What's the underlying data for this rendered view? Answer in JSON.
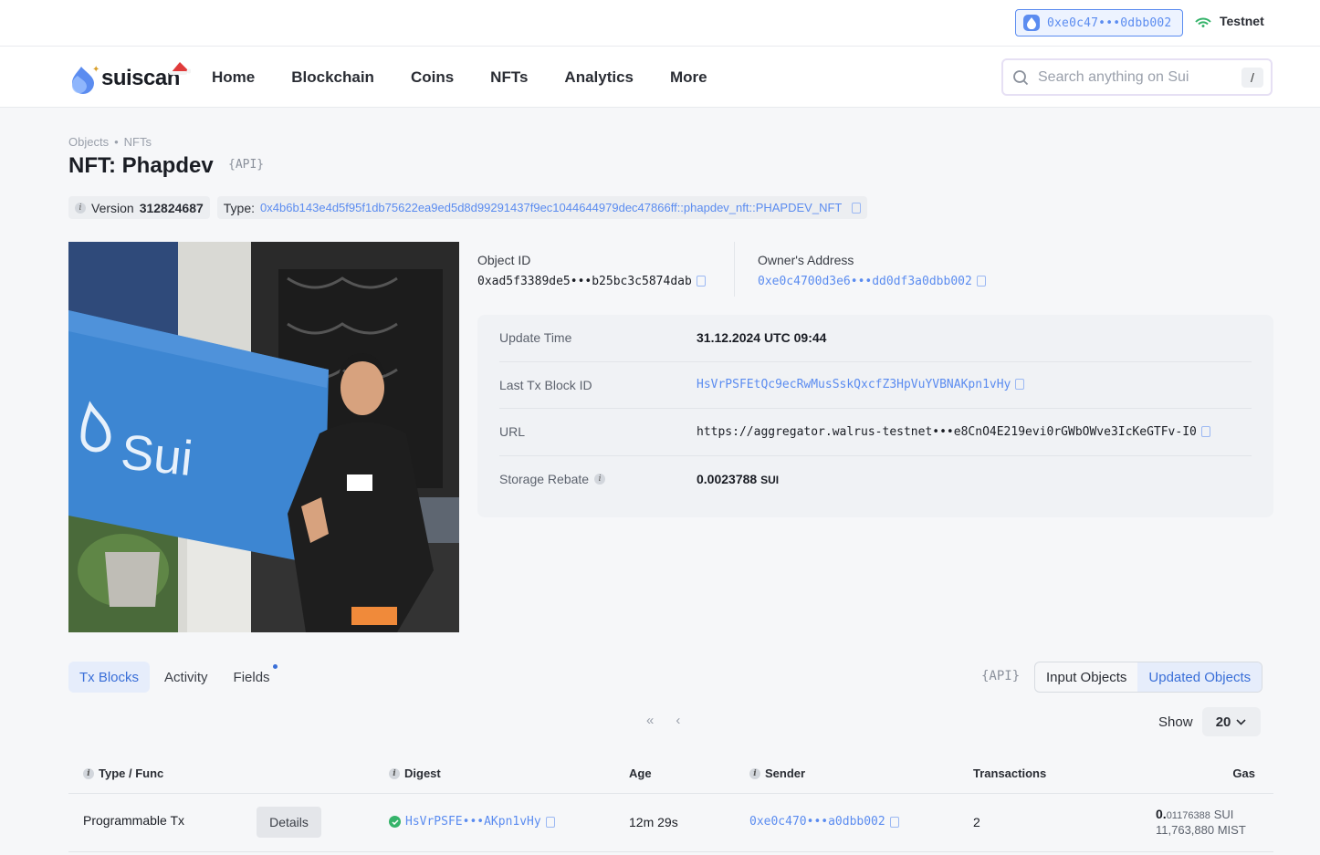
{
  "topbar": {
    "wallet_address": "0xe0c47•••0dbb002",
    "network": "Testnet"
  },
  "nav": {
    "logo_text": "suiscan",
    "items": [
      "Home",
      "Blockchain",
      "Coins",
      "NFTs",
      "Analytics",
      "More"
    ],
    "search_placeholder": "Search anything on Sui",
    "search_shortcut": "/"
  },
  "breadcrumb": {
    "items": [
      "Objects",
      "NFTs"
    ],
    "separator": "•"
  },
  "page": {
    "title": "NFT: Phapdev",
    "api_label": "{API}",
    "version_label": "Version",
    "version_value": "312824687",
    "type_label": "Type:",
    "type_value": "0x4b6b143e4d5f95f1db75622ea9ed5d8d99291437f9ec1044644979dec47866ff::phapdev_nft::PHAPDEV_NFT"
  },
  "ids": {
    "object_id_label": "Object ID",
    "object_id_value": "0xad5f3389de5•••b25bc3c5874dab",
    "owner_label": "Owner's Address",
    "owner_value": "0xe0c4700d3e6•••dd0df3a0dbb002"
  },
  "details": {
    "update_time_label": "Update Time",
    "update_time_value": "31.12.2024 UTC 09:44",
    "last_tx_label": "Last Tx Block ID",
    "last_tx_value": "HsVrPSFEtQc9ecRwMusSskQxcfZ3HpVuYVBNAKpn1vHy",
    "url_label": "URL",
    "url_value": "https://aggregator.walrus-testnet•••e8CnO4E219evi0rGWbOWve3IcKeGTFv-I0",
    "rebate_label": "Storage Rebate",
    "rebate_value": "0.0023788",
    "rebate_unit": "SUI"
  },
  "nft_image": {
    "flag_text": "Sui"
  },
  "tabs": {
    "items": [
      "Tx Blocks",
      "Activity",
      "Fields"
    ],
    "active": "Tx Blocks",
    "api_label": "{API}",
    "filter_input": "Input Objects",
    "filter_updated": "Updated Objects"
  },
  "pagination": {
    "first": "«",
    "prev": "‹",
    "show_label": "Show",
    "show_value": "20"
  },
  "table": {
    "headers": {
      "type": "Type / Func",
      "digest": "Digest",
      "age": "Age",
      "sender": "Sender",
      "transactions": "Transactions",
      "gas": "Gas"
    },
    "rows": [
      {
        "type": "Programmable Tx",
        "details": "Details",
        "digest": "HsVrPSFE•••AKpn1vHy",
        "age": "12m 29s",
        "sender": "0xe0c470•••a0dbb002",
        "transactions": "2",
        "gas_int": "0.",
        "gas_dec": "01176388",
        "gas_unit": "SUI",
        "gas_mist": "11,763,880 MIST"
      }
    ]
  },
  "colors": {
    "accent": "#5b8cf0",
    "success": "#35b36a",
    "flag_blue": "#3d86d2"
  }
}
